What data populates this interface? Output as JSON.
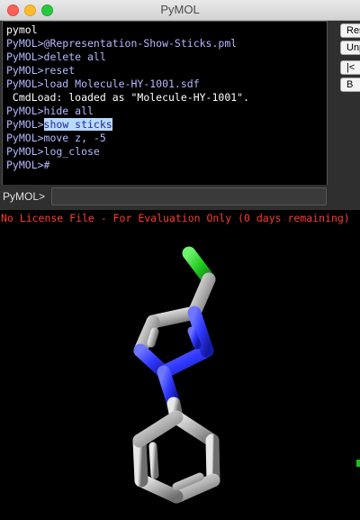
{
  "window": {
    "title": "PyMOL"
  },
  "console": {
    "lines": [
      {
        "text": "pymol",
        "style": "white"
      },
      {
        "text": "PyMOL>@Representation-Show-Sticks.pml",
        "style": "blue"
      },
      {
        "text": "PyMOL>delete all",
        "style": "blue"
      },
      {
        "text": "PyMOL>reset",
        "style": "blue"
      },
      {
        "text": "PyMOL>load Molecule-HY-1001.sdf",
        "style": "blue"
      },
      {
        "text": " CmdLoad: loaded as \"Molecule-HY-1001\".",
        "style": "out"
      },
      {
        "text": "PyMOL>hide all",
        "style": "blue"
      },
      {
        "prefix": "PyMOL>",
        "selected": "show sticks",
        "style": "blue"
      },
      {
        "text": "PyMOL>move z, -5",
        "style": "blue"
      },
      {
        "text": "PyMOL>log_close",
        "style": "blue"
      },
      {
        "text": "PyMOL>#",
        "style": "blue"
      }
    ]
  },
  "side_buttons": {
    "reset": "Res",
    "unpick": "Unp",
    "rewind": "|<",
    "b": "B"
  },
  "command": {
    "label": "PyMOL>",
    "value": ""
  },
  "viewer": {
    "license_text": "No License File - For Evaluation Only (0 days remaining)",
    "molecule_name": "Molecule-HY-1001",
    "representation": "sticks",
    "colors": {
      "carbon": "#b0b0b0",
      "nitrogen": "#2f38ff",
      "chlorine": "#22cc22",
      "background": "#000000"
    }
  }
}
